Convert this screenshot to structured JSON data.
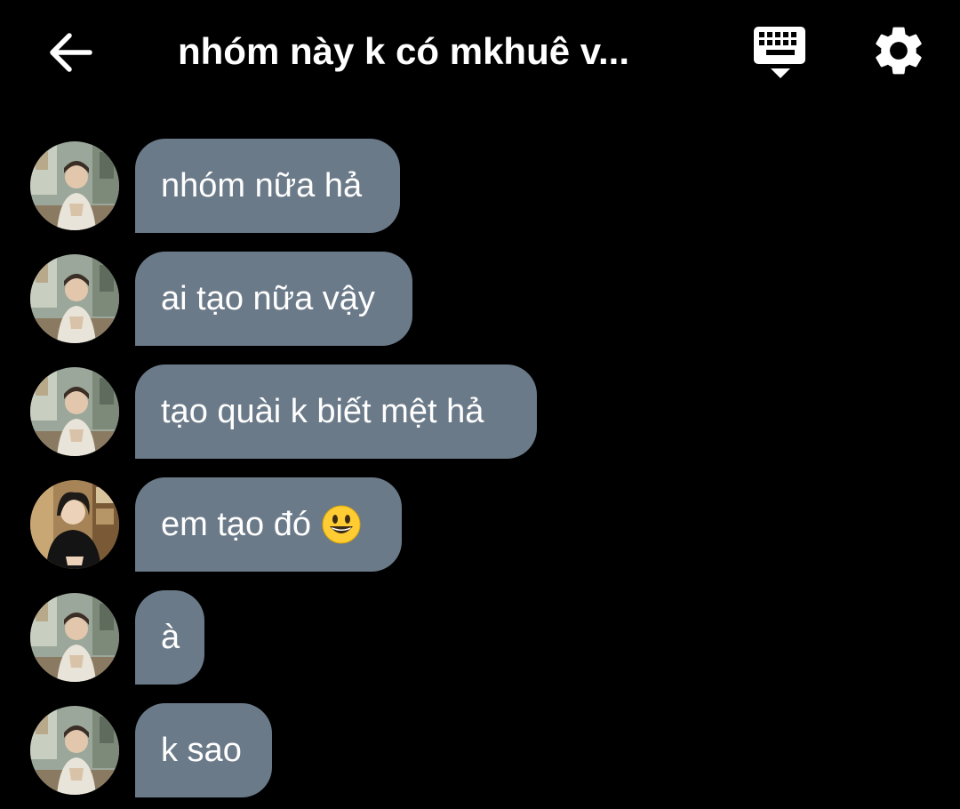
{
  "header": {
    "title": "nhóm này k có mkhuê v...",
    "back_icon": "arrow-left-icon",
    "keyboard_icon": "keyboard-icon",
    "settings_icon": "gear-icon"
  },
  "colors": {
    "background": "#000000",
    "bubble": "#6b7a89",
    "text": "#ffffff"
  },
  "messages": [
    {
      "text": "nhóm nữa hả",
      "avatar": "avatar-a"
    },
    {
      "text": "ai tạo nữa vậy",
      "avatar": "avatar-a"
    },
    {
      "text": "tạo quài k biết mệt hả",
      "avatar": "avatar-a"
    },
    {
      "text": "em tạo đó",
      "emoji": "grinning-face-emoji",
      "avatar": "avatar-b"
    },
    {
      "text": "à",
      "avatar": "avatar-a"
    },
    {
      "text": "k sao",
      "avatar": "avatar-a"
    }
  ]
}
